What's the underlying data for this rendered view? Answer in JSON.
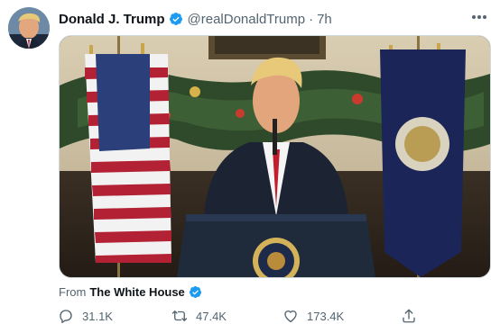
{
  "tweet": {
    "author": {
      "display_name": "Donald J. Trump",
      "handle": "@realDonaldTrump",
      "verified": true,
      "avatar_icon": "profile-photo"
    },
    "separator": "·",
    "time": "7h",
    "more_icon": "more-horizontal-icon",
    "media": {
      "type": "video",
      "description_icons": [
        "american-flag",
        "presidential-flag",
        "podium-seal",
        "christmas-garland"
      ]
    },
    "source": {
      "prefix": "From",
      "name": "The White House",
      "verified": true
    },
    "actions": {
      "replies": "31.1K",
      "retweets": "47.4K",
      "likes": "173.4K"
    }
  },
  "colors": {
    "text_primary": "#0f1419",
    "text_secondary": "#536471",
    "verified_blue": "#1d9bf0",
    "border": "#cfd9de"
  }
}
